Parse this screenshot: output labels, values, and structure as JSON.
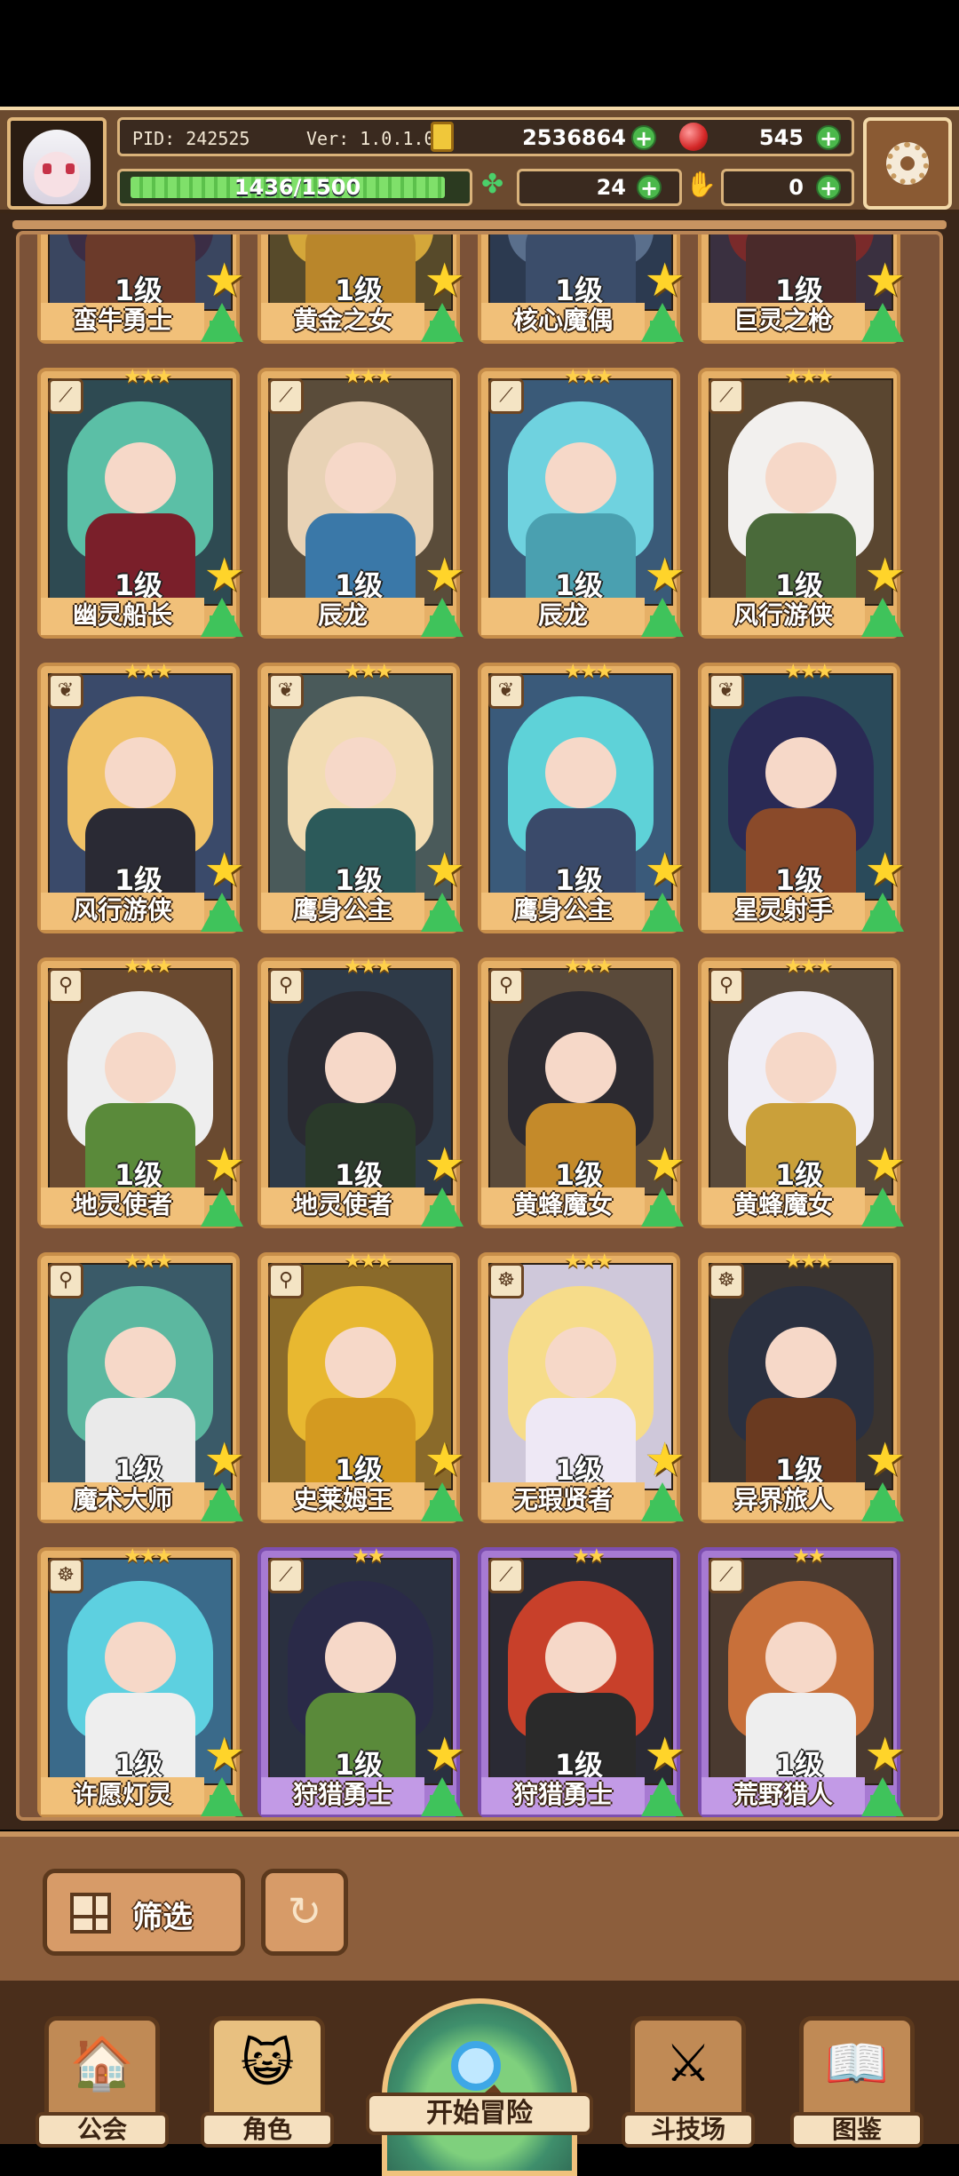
{
  "header": {
    "pid": "PID: 242525",
    "version": "Ver: 1.0.1.0",
    "gold": "2536864",
    "gems": "545",
    "energy": "1436/1500",
    "energy_fraction": 0.957,
    "clover": "24",
    "keys": "0"
  },
  "cards": [
    {
      "name": "蛮牛勇士",
      "level": "1级",
      "stars": "",
      "frame": "gold",
      "hair": "#3b2d45",
      "body": "#6b3a2a",
      "bg": "#3a4660",
      "icon": "⚔"
    },
    {
      "name": "黄金之女",
      "level": "1级",
      "stars": "",
      "frame": "gold",
      "hair": "#d4a73a",
      "body": "#b9862b",
      "bg": "#574a2a",
      "icon": "⚔"
    },
    {
      "name": "核心魔偶",
      "level": "1级",
      "stars": "",
      "frame": "gold",
      "hair": "#5a6f8c",
      "body": "#3b4d6a",
      "bg": "#2c3a50",
      "icon": "⚔"
    },
    {
      "name": "巨灵之枪",
      "level": "1级",
      "stars": "",
      "frame": "gold",
      "hair": "#7a2a2a",
      "body": "#4a2a2a",
      "bg": "#3a3040",
      "icon": "⚔"
    },
    {
      "name": "幽灵船长",
      "level": "1级",
      "stars": "★★★",
      "frame": "gold",
      "hair": "#5bbfa6",
      "body": "#7a1f2a",
      "bg": "#2e4a52",
      "icon": "⟋"
    },
    {
      "name": "辰龙",
      "level": "1级",
      "stars": "★★★",
      "frame": "gold",
      "hair": "#e8d2b5",
      "body": "#3a78a8",
      "bg": "#5a4c3a",
      "icon": "⟋"
    },
    {
      "name": "辰龙",
      "level": "1级",
      "stars": "★★★",
      "frame": "gold",
      "hair": "#6fd2df",
      "body": "#4aa0b0",
      "bg": "#3a5a78",
      "icon": "⟋"
    },
    {
      "name": "风行游侠",
      "level": "1级",
      "stars": "★★★",
      "frame": "gold",
      "hair": "#f2f0ee",
      "body": "#4a6a3a",
      "bg": "#5a4630",
      "icon": "⟋"
    },
    {
      "name": "风行游侠",
      "level": "1级",
      "stars": "★★★",
      "frame": "gold",
      "hair": "#f0c267",
      "body": "#2a2a34",
      "bg": "#3a4a6a",
      "icon": "❦"
    },
    {
      "name": "鹰身公主",
      "level": "1级",
      "stars": "★★★",
      "frame": "gold",
      "hair": "#f2dcb2",
      "body": "#2c5a5a",
      "bg": "#4a5a5a",
      "icon": "❦"
    },
    {
      "name": "鹰身公主",
      "level": "1级",
      "stars": "★★★",
      "frame": "gold",
      "hair": "#5ed2d8",
      "body": "#3a4a6a",
      "bg": "#3a5a7a",
      "icon": "❦"
    },
    {
      "name": "星灵射手",
      "level": "1级",
      "stars": "★★★",
      "frame": "gold",
      "hair": "#2a2a55",
      "body": "#8a4a2a",
      "bg": "#2a4a5a",
      "icon": "❦"
    },
    {
      "name": "地灵使者",
      "level": "1级",
      "stars": "★★★",
      "frame": "gold",
      "hair": "#eeeeee",
      "body": "#5a8a3a",
      "bg": "#6a4a30",
      "icon": "⚲"
    },
    {
      "name": "地灵使者",
      "level": "1级",
      "stars": "★★★",
      "frame": "gold",
      "hair": "#2a2a32",
      "body": "#2a3a2a",
      "bg": "#2e3a48",
      "icon": "⚲"
    },
    {
      "name": "黄蜂魔女",
      "level": "1级",
      "stars": "★★★",
      "frame": "gold",
      "hair": "#2c2a30",
      "body": "#c48a2a",
      "bg": "#5a4a3a",
      "icon": "⚲"
    },
    {
      "name": "黄蜂魔女",
      "level": "1级",
      "stars": "★★★",
      "frame": "gold",
      "hair": "#f0eef5",
      "body": "#caa03a",
      "bg": "#5a4a3a",
      "icon": "⚲"
    },
    {
      "name": "魔术大师",
      "level": "1级",
      "stars": "★★★",
      "frame": "gold",
      "hair": "#5cb8a0",
      "body": "#eaeaea",
      "bg": "#3a5a68",
      "icon": "⚲"
    },
    {
      "name": "史莱姆王",
      "level": "1级",
      "stars": "★★★",
      "frame": "gold",
      "hair": "#e8b830",
      "body": "#d49a20",
      "bg": "#8a6a2a",
      "icon": "⚲"
    },
    {
      "name": "无瑕贤者",
      "level": "1级",
      "stars": "★★★",
      "frame": "gold",
      "hair": "#f6dc8a",
      "body": "#eee8f5",
      "bg": "#cfc8da",
      "icon": "☸"
    },
    {
      "name": "异界旅人",
      "level": "1级",
      "stars": "★★★",
      "frame": "gold",
      "hair": "#2a3040",
      "body": "#6a3a20",
      "bg": "#3a3430",
      "icon": "☸"
    },
    {
      "name": "许愿灯灵",
      "level": "1级",
      "stars": "★★★",
      "frame": "gold",
      "hair": "#5dd0e0",
      "body": "#eeeeee",
      "bg": "#3a6a8a",
      "icon": "☸"
    },
    {
      "name": "狩猎勇士",
      "level": "1级",
      "stars": "★★",
      "frame": "purple",
      "hair": "#2a2a48",
      "body": "#5a8a3a",
      "bg": "#2a3040",
      "icon": "⟋"
    },
    {
      "name": "狩猎勇士",
      "level": "1级",
      "stars": "★★",
      "frame": "purple",
      "hair": "#c8402a",
      "body": "#2a2a2a",
      "bg": "#2a2a34",
      "icon": "⟋"
    },
    {
      "name": "荒野猎人",
      "level": "1级",
      "stars": "★★",
      "frame": "purple",
      "hair": "#c8703a",
      "body": "#eeeeee",
      "bg": "#4a3a30",
      "icon": "⟋"
    }
  ],
  "controls": {
    "filter_label": "筛选"
  },
  "nav": {
    "guild": "公会",
    "heroes": "角色",
    "adventure": "开始冒险",
    "arena": "斗技场",
    "codex": "图鉴"
  }
}
